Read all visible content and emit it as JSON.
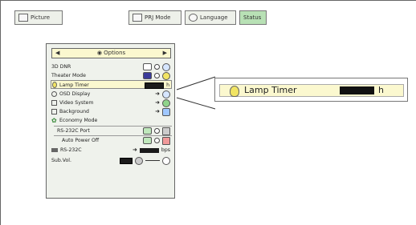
{
  "tabs": [
    {
      "label": "Picture",
      "icon": "picture-icon",
      "active": false
    },
    {
      "label": "PRJ Mode",
      "icon": "prj-mode-icon",
      "active": false
    },
    {
      "label": "Language",
      "icon": "language-icon",
      "active": false
    },
    {
      "label": "Status",
      "icon": "",
      "active": true
    }
  ],
  "menu": {
    "title": "Options",
    "rows": [
      {
        "label": "3D DNR"
      },
      {
        "label": "Theater Mode"
      },
      {
        "label": "Lamp Timer",
        "value_unit": "h"
      },
      {
        "label": "OSD Display"
      },
      {
        "label": "Video System"
      },
      {
        "label": "Background"
      },
      {
        "label": "Economy Mode"
      },
      {
        "label": "RS-232C Port"
      },
      {
        "label": "Auto Power Off"
      },
      {
        "label": "RS-232C",
        "unit": "bps"
      },
      {
        "label": "Sub.Vol."
      }
    ]
  },
  "zoom": {
    "label": "Lamp Timer",
    "unit": "h"
  },
  "colors": {
    "highlight": "#fbf8cf",
    "menu_bg": "#eff2ec",
    "active_tab": "#b8e1b5"
  }
}
